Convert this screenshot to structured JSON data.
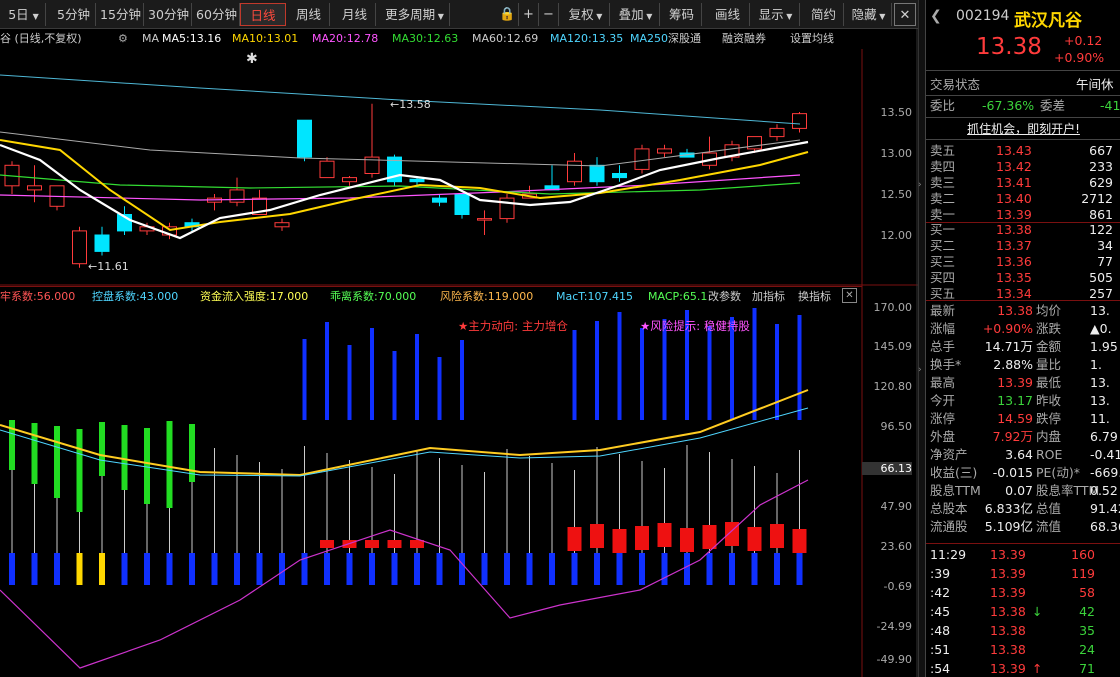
{
  "toolbar": {
    "periods": [
      "5日",
      "5分钟",
      "15分钟",
      "30分钟",
      "60分钟",
      "日线",
      "周线",
      "月线",
      "更多周期"
    ],
    "active_period": "日线",
    "tools": [
      "复权",
      "叠加",
      "筹码",
      "画线",
      "显示",
      "简约",
      "隐藏"
    ]
  },
  "ma_bar": {
    "prefix": "谷 (日线,不复权)",
    "ma_label": "MA",
    "ma5": "MA5:13.16",
    "ma10": "MA10:13.01",
    "ma20": "MA20:12.78",
    "ma30": "MA30:12.63",
    "ma60": "MA60:12.69",
    "ma120": "MA120:13.35",
    "ma250": "MA250",
    "links": [
      "深股通",
      "融资融券",
      "设置均线"
    ]
  },
  "price_axis": [
    "13.50",
    "13.00",
    "12.50",
    "12.00"
  ],
  "price_annotations": {
    "high": "13.58",
    "low": "11.61"
  },
  "indicator_bar": {
    "items": [
      {
        "text": "牢系数:56.000",
        "color": "#ff5555"
      },
      {
        "text": "控盘系数:43.000",
        "color": "#4fd6ff"
      },
      {
        "text": "资金流入强度:17.000",
        "color": "#ffff55"
      },
      {
        "text": "乖离系数:70.000",
        "color": "#55ff55"
      },
      {
        "text": "风险系数:119.000",
        "color": "#ffb84d"
      },
      {
        "text": "MacT:107.415",
        "color": "#4fd6ff"
      },
      {
        "text": "MACP:65.1",
        "color": "#55ff55"
      }
    ],
    "links": [
      "改参数",
      "加指标",
      "换指标"
    ],
    "signal1": "★主力动向: 主力增仓",
    "signal2": "★风险提示: 稳健持股"
  },
  "indicator_axis": [
    "170.00",
    "145.09",
    "120.80",
    "96.50",
    "66.13",
    "47.90",
    "23.60",
    "-0.69",
    "-24.99",
    "-49.90"
  ],
  "quote": {
    "code": "002194",
    "name": "武汉凡谷",
    "price": "13.38",
    "change": "+0.12",
    "change_pct": "+0.90%",
    "status_label": "交易状态",
    "status_value": "午间休",
    "weibi_label": "委比",
    "weibi_value": "-67.36%",
    "weicha_label": "委差",
    "weicha_value": "-41",
    "promo": "抓住机会，即刻开户!"
  },
  "order_book": {
    "asks": [
      {
        "label": "卖五",
        "price": "13.43",
        "vol": "667"
      },
      {
        "label": "卖四",
        "price": "13.42",
        "vol": "233"
      },
      {
        "label": "卖三",
        "price": "13.41",
        "vol": "629"
      },
      {
        "label": "卖二",
        "price": "13.40",
        "vol": "2712"
      },
      {
        "label": "卖一",
        "price": "13.39",
        "vol": "861"
      }
    ],
    "bids": [
      {
        "label": "买一",
        "price": "13.38",
        "vol": "122"
      },
      {
        "label": "买二",
        "price": "13.37",
        "vol": "34"
      },
      {
        "label": "买三",
        "price": "13.36",
        "vol": "77"
      },
      {
        "label": "买四",
        "price": "13.35",
        "vol": "505"
      },
      {
        "label": "买五",
        "price": "13.34",
        "vol": "257"
      }
    ]
  },
  "stats": [
    {
      "l1": "最新",
      "v1": "13.38",
      "c1": "red",
      "l2": "均价",
      "v2": "13."
    },
    {
      "l1": "涨幅",
      "v1": "+0.90%",
      "c1": "red",
      "l2": "涨跌",
      "v2": "▲0."
    },
    {
      "l1": "总手",
      "v1": "14.71万",
      "c1": "white",
      "l2": "金额",
      "v2": "1.95"
    },
    {
      "l1": "换手*",
      "v1": "2.88%",
      "c1": "white",
      "l2": "量比",
      "v2": "1."
    },
    {
      "l1": "最高",
      "v1": "13.39",
      "c1": "red",
      "l2": "最低",
      "v2": "13."
    },
    {
      "l1": "今开",
      "v1": "13.17",
      "c1": "green",
      "l2": "昨收",
      "v2": "13."
    },
    {
      "l1": "涨停",
      "v1": "14.59",
      "c1": "red",
      "l2": "跌停",
      "v2": "11."
    },
    {
      "l1": "外盘",
      "v1": "7.92万",
      "c1": "red",
      "l2": "内盘",
      "v2": "6.79"
    },
    {
      "l1": "净资产",
      "v1": "3.64",
      "c1": "white",
      "l2": "ROE",
      "v2": "-0.41"
    },
    {
      "l1": "收益(三)",
      "v1": "-0.015",
      "c1": "white",
      "l2": "PE(动)*",
      "v2": "-669."
    },
    {
      "l1": "股息TTM",
      "v1": "0.07",
      "c1": "white",
      "l2": "股息率TTM",
      "v2": "0.52"
    },
    {
      "l1": "总股本",
      "v1": "6.833亿",
      "c1": "white",
      "l2": "总值",
      "v2": "91.42"
    },
    {
      "l1": "流通股",
      "v1": "5.109亿",
      "c1": "white",
      "l2": "流值",
      "v2": "68.36"
    }
  ],
  "ticks": [
    {
      "time": "11:29",
      "price": "13.39",
      "vol": "160",
      "arrow": ""
    },
    {
      "time": ":39",
      "price": "13.39",
      "vol": "119",
      "arrow": ""
    },
    {
      "time": ":42",
      "price": "13.39",
      "vol": "58",
      "arrow": ""
    },
    {
      "time": ":45",
      "price": "13.38",
      "vol": "42",
      "arrow": "↓"
    },
    {
      "time": ":48",
      "price": "13.38",
      "vol": "35",
      "arrow": ""
    },
    {
      "time": ":51",
      "price": "13.38",
      "vol": "24",
      "arrow": ""
    },
    {
      "time": ":54",
      "price": "13.39",
      "vol": "71",
      "arrow": "↑"
    }
  ],
  "colors": {
    "up": "#ff3b3b",
    "down": "#00e5ff",
    "ma5": "#ffffff",
    "ma10": "#ffd700",
    "ma20": "#ff55ff",
    "ma30": "#33dd33",
    "ma120": "#4fb8d6",
    "bg": "#000000"
  }
}
